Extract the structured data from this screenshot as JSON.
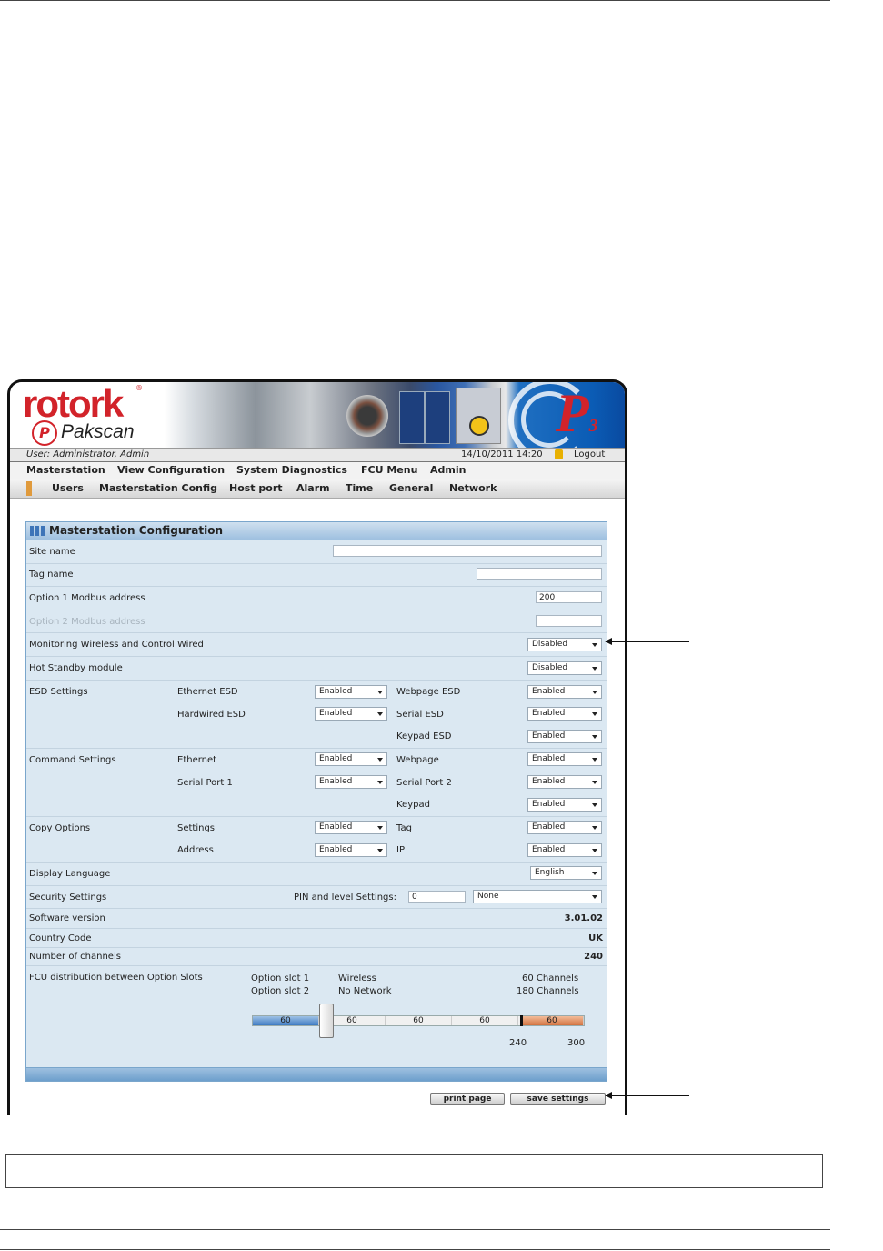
{
  "brand": {
    "name": "rotork",
    "product": "Pakscan",
    "p_letter": "P",
    "generation": "P",
    "generation_sub": "3"
  },
  "userbar": {
    "user": "User: Administrator, Admin",
    "datetime": "14/10/2011 14:20",
    "logout": "Logout"
  },
  "menu": [
    "Masterstation",
    "View Configuration",
    "System Diagnostics",
    "FCU Menu",
    "Admin"
  ],
  "submenu": [
    "Users",
    "Masterstation Config",
    "Host port",
    "Alarm",
    "Time",
    "General",
    "Network"
  ],
  "panel": {
    "title": "Masterstation Configuration",
    "site_name": {
      "label": "Site name",
      "value": ""
    },
    "tag_name": {
      "label": "Tag name",
      "value": ""
    },
    "opt1": {
      "label": "Option 1 Modbus address",
      "value": "200"
    },
    "opt2": {
      "label": "Option 2 Modbus address",
      "value": ""
    },
    "monitoring": {
      "label": "Monitoring Wireless and Control Wired",
      "value": "Disabled"
    },
    "hot_standby": {
      "label": "Hot Standby module",
      "value": "Disabled"
    },
    "esd": {
      "label": "ESD Settings",
      "ethernet": {
        "label": "Ethernet ESD",
        "value": "Enabled"
      },
      "hardwired": {
        "label": "Hardwired ESD",
        "value": "Enabled"
      },
      "webpage": {
        "label": "Webpage ESD",
        "value": "Enabled"
      },
      "serial": {
        "label": "Serial ESD",
        "value": "Enabled"
      },
      "keypad": {
        "label": "Keypad ESD",
        "value": "Enabled"
      }
    },
    "command": {
      "label": "Command Settings",
      "ethernet": {
        "label": "Ethernet",
        "value": "Enabled"
      },
      "serial1": {
        "label": "Serial Port 1",
        "value": "Enabled"
      },
      "webpage": {
        "label": "Webpage",
        "value": "Enabled"
      },
      "serial2": {
        "label": "Serial Port 2",
        "value": "Enabled"
      },
      "keypad": {
        "label": "Keypad",
        "value": "Enabled"
      }
    },
    "copy": {
      "label": "Copy Options",
      "settings": {
        "label": "Settings",
        "value": "Enabled"
      },
      "address": {
        "label": "Address",
        "value": "Enabled"
      },
      "tag": {
        "label": "Tag",
        "value": "Enabled"
      },
      "ip": {
        "label": "IP",
        "value": "Enabled"
      }
    },
    "language": {
      "label": "Display Language",
      "value": "English"
    },
    "security": {
      "label": "Security Settings",
      "pin_label": "PIN and level Settings:",
      "pin_value": "0",
      "level_value": "None"
    },
    "software": {
      "label": "Software version",
      "value": "3.01.02"
    },
    "country": {
      "label": "Country Code",
      "value": "UK"
    },
    "channels": {
      "label": "Number of channels",
      "value": "240"
    },
    "fcu": {
      "label": "FCU distribution between Option Slots",
      "slot1": {
        "label": "Option slot 1",
        "type": "Wireless",
        "channels": "60 Channels"
      },
      "slot2": {
        "label": "Option slot 2",
        "type": "No Network",
        "channels": "180 Channels"
      },
      "segments": [
        "60",
        "60",
        "60",
        "60",
        "60"
      ],
      "slider_fraction": 0.25,
      "tick_240": "240",
      "tick_300": "300"
    }
  },
  "buttons": {
    "print": "print page",
    "save": "save settings"
  }
}
